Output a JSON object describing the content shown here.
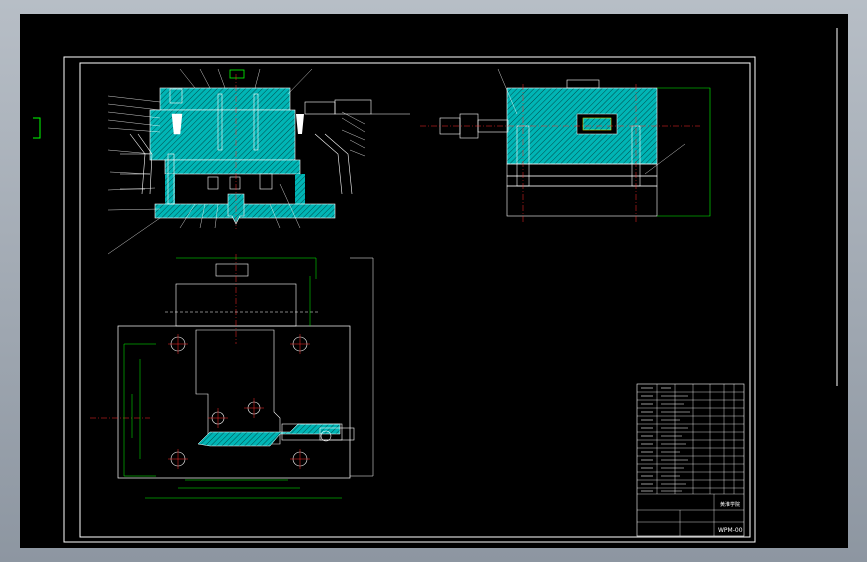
{
  "title_block": {
    "drawing_number": "WPM-00",
    "school_text": "黄淮学院"
  },
  "colors": {
    "background": "#000000",
    "border": "#ffffff",
    "hatch": "#00b5b5",
    "dimension": "#00ff00",
    "center_line": "#ff2a2a",
    "part": "#ffffff",
    "accent": "#ffff00"
  }
}
